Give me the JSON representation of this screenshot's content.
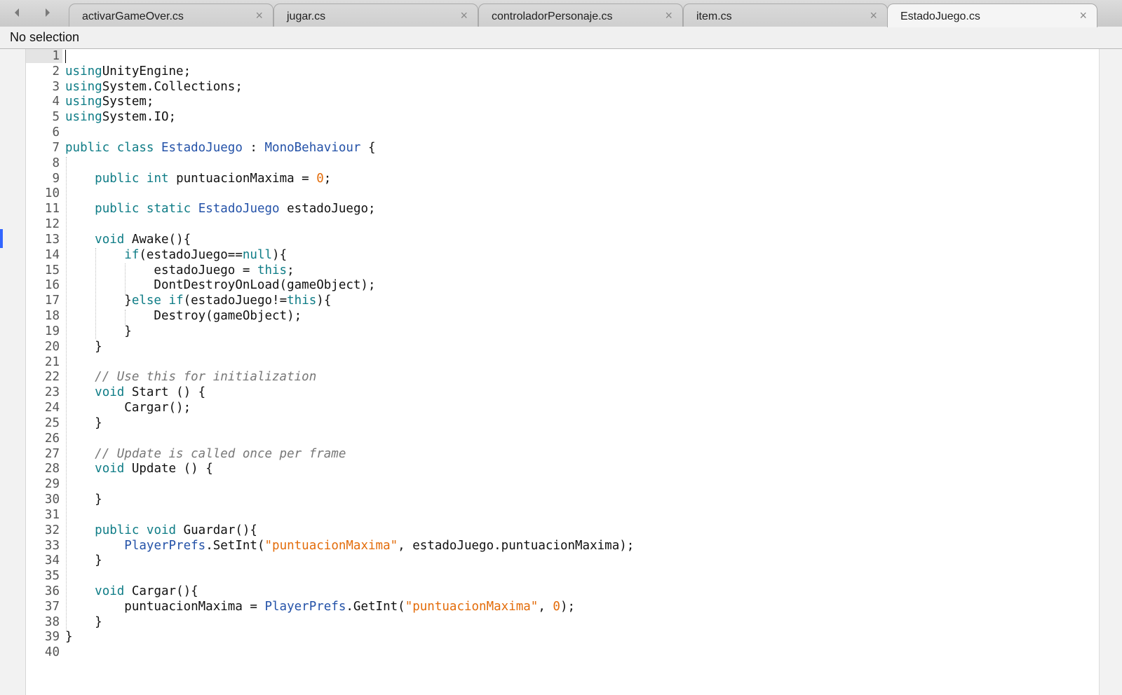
{
  "tabs": [
    {
      "label": "activarGameOver.cs",
      "active": false
    },
    {
      "label": "jugar.cs",
      "active": false
    },
    {
      "label": "controladorPersonaje.cs",
      "active": false
    },
    {
      "label": "item.cs",
      "active": false
    },
    {
      "label": "EstadoJuego.cs",
      "active": true
    }
  ],
  "icons": {
    "back": "chevron-left-icon",
    "forward": "chevron-right-icon",
    "close": "×"
  },
  "status": {
    "text": "No selection"
  },
  "editor": {
    "current_line": 1,
    "colors": {
      "keyword": "#0e7c86",
      "type": "#2452a8",
      "string": "#e36c0a",
      "comment": "#777777",
      "selection_marker": "#3366ff"
    },
    "lines": [
      [],
      [
        [
          "kw",
          "using"
        ],
        [
          "",
          "UnityEngine;"
        ]
      ],
      [
        [
          "kw",
          "using"
        ],
        [
          "",
          "System.Collections;"
        ]
      ],
      [
        [
          "kw",
          "using"
        ],
        [
          "",
          "System;"
        ]
      ],
      [
        [
          "kw",
          "using"
        ],
        [
          "",
          "System.IO;"
        ]
      ],
      [],
      [
        [
          "kw",
          "public"
        ],
        [
          "kw",
          "class"
        ],
        [
          "typ",
          "EstadoJuego"
        ],
        [
          "",
          " : "
        ],
        [
          "typ",
          "MonoBehaviour"
        ],
        [
          "",
          " {"
        ]
      ],
      [],
      [
        [
          "",
          "    "
        ],
        [
          "kw",
          "public"
        ],
        [
          "",
          " "
        ],
        [
          "kw",
          "int"
        ],
        [
          "",
          " puntuacionMaxima = "
        ],
        [
          "num",
          "0"
        ],
        [
          "",
          ";"
        ]
      ],
      [],
      [
        [
          "",
          "    "
        ],
        [
          "kw",
          "public"
        ],
        [
          "",
          " "
        ],
        [
          "kw",
          "static"
        ],
        [
          "",
          " "
        ],
        [
          "typ",
          "EstadoJuego"
        ],
        [
          "",
          " estadoJuego;"
        ]
      ],
      [],
      [
        [
          "",
          "    "
        ],
        [
          "kw",
          "void"
        ],
        [
          "",
          " Awake(){"
        ]
      ],
      [
        [
          "",
          "        "
        ],
        [
          "kw",
          "if"
        ],
        [
          "",
          "(estadoJuego=="
        ],
        [
          "kw",
          "null"
        ],
        [
          "",
          "){"
        ]
      ],
      [
        [
          "",
          "            estadoJuego = "
        ],
        [
          "kw",
          "this"
        ],
        [
          "",
          ";"
        ]
      ],
      [
        [
          "",
          "            DontDestroyOnLoad(gameObject);"
        ]
      ],
      [
        [
          "",
          "        }"
        ],
        [
          "kw",
          "else"
        ],
        [
          "",
          " "
        ],
        [
          "kw",
          "if"
        ],
        [
          "",
          "(estadoJuego!="
        ],
        [
          "kw",
          "this"
        ],
        [
          "",
          "){"
        ]
      ],
      [
        [
          "",
          "            Destroy(gameObject);"
        ]
      ],
      [
        [
          "",
          "        }"
        ]
      ],
      [
        [
          "",
          "    }"
        ]
      ],
      [],
      [
        [
          "",
          "    "
        ],
        [
          "cmt",
          "// Use this for initialization"
        ]
      ],
      [
        [
          "",
          "    "
        ],
        [
          "kw",
          "void"
        ],
        [
          "",
          " Start () {"
        ]
      ],
      [
        [
          "",
          "        Cargar();"
        ]
      ],
      [
        [
          "",
          "    }"
        ]
      ],
      [],
      [
        [
          "",
          "    "
        ],
        [
          "cmt",
          "// Update is called once per frame"
        ]
      ],
      [
        [
          "",
          "    "
        ],
        [
          "kw",
          "void"
        ],
        [
          "",
          " Update () {"
        ]
      ],
      [],
      [
        [
          "",
          "    }"
        ]
      ],
      [],
      [
        [
          "",
          "    "
        ],
        [
          "kw",
          "public"
        ],
        [
          "",
          " "
        ],
        [
          "kw",
          "void"
        ],
        [
          "",
          " Guardar(){"
        ]
      ],
      [
        [
          "",
          "        "
        ],
        [
          "typ",
          "PlayerPrefs"
        ],
        [
          "",
          ".SetInt("
        ],
        [
          "str",
          "\"puntuacionMaxima\""
        ],
        [
          "",
          ", estadoJuego.puntuacionMaxima);"
        ]
      ],
      [
        [
          "",
          "    }"
        ]
      ],
      [],
      [
        [
          "",
          "    "
        ],
        [
          "kw",
          "void"
        ],
        [
          "",
          " Cargar(){"
        ]
      ],
      [
        [
          "",
          "        puntuacionMaxima = "
        ],
        [
          "typ",
          "PlayerPrefs"
        ],
        [
          "",
          ".GetInt("
        ],
        [
          "str",
          "\"puntuacionMaxima\""
        ],
        [
          "",
          ", "
        ],
        [
          "num",
          "0"
        ],
        [
          "",
          ");"
        ]
      ],
      [
        [
          "",
          "    }"
        ]
      ],
      [
        [
          "",
          "}"
        ]
      ],
      []
    ]
  }
}
